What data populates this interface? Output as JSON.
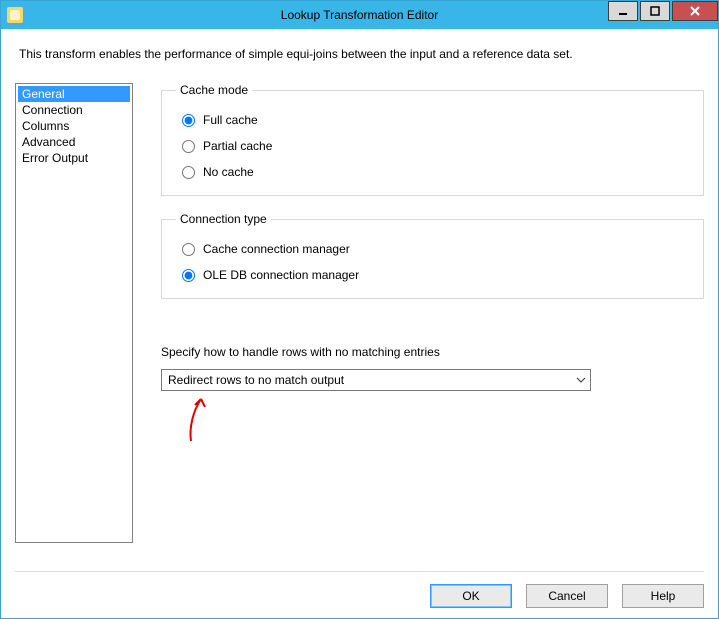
{
  "window": {
    "title": "Lookup Transformation Editor"
  },
  "description": "This transform enables the performance of simple equi-joins between the input and a reference data set.",
  "nav": {
    "items": [
      "General",
      "Connection",
      "Columns",
      "Advanced",
      "Error Output"
    ],
    "selected_index": 0
  },
  "cache_mode": {
    "legend": "Cache mode",
    "options": [
      "Full cache",
      "Partial cache",
      "No cache"
    ],
    "selected_index": 0
  },
  "connection_type": {
    "legend": "Connection type",
    "options": [
      "Cache connection manager",
      "OLE DB connection manager"
    ],
    "selected_index": 1
  },
  "no_match": {
    "label": "Specify how to handle rows with no matching entries",
    "selected": "Redirect rows to no match output"
  },
  "buttons": {
    "ok": "OK",
    "cancel": "Cancel",
    "help": "Help"
  }
}
